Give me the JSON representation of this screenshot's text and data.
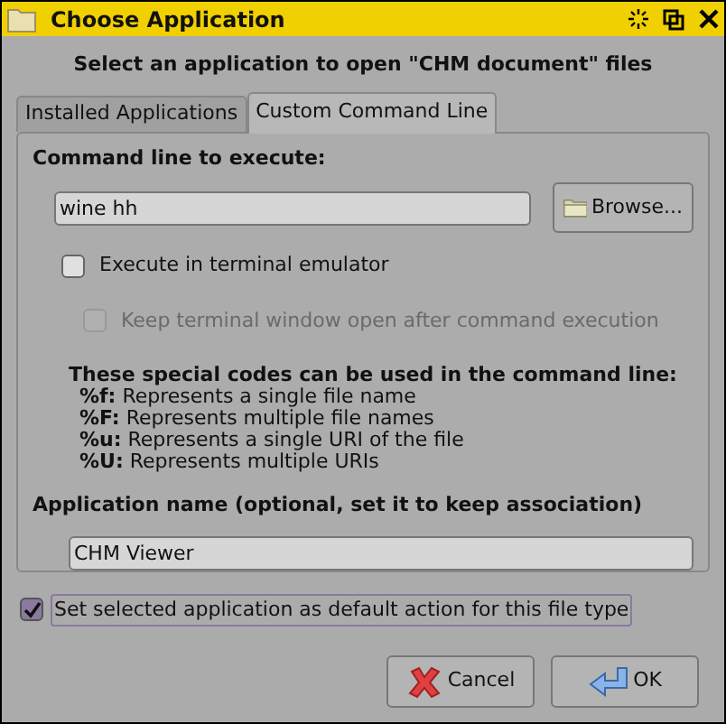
{
  "window": {
    "title": "Choose Application"
  },
  "message": "Select an application to open \"CHM document\" files",
  "tabs": [
    {
      "label": "Installed Applications",
      "selected": false
    },
    {
      "label": "Custom Command Line",
      "selected": true
    }
  ],
  "command_label": "Command line to execute:",
  "command_field": {
    "value": "wine hh"
  },
  "browse_button": "Browse...",
  "options": [
    {
      "label": "Execute in terminal emulator",
      "checked": false,
      "disabled": false
    },
    {
      "label": "Keep terminal window open after command execution",
      "checked": false,
      "disabled": true
    }
  ],
  "codes_heading": "These special codes can be used in the command line:",
  "codes": [
    {
      "code": "%f:",
      "text": "Represents a single file name"
    },
    {
      "code": "%F:",
      "text": "Represents multiple file names"
    },
    {
      "code": "%u:",
      "text": "Represents a single URI of the file"
    },
    {
      "code": "%U:",
      "text": "Represents multiple URIs"
    }
  ],
  "app_name_label": "Application name (optional, set it to keep association)",
  "app_name_field": {
    "value": "CHM Viewer"
  },
  "default_checkbox": {
    "label": "Set selected application as default action for this file type",
    "checked": true
  },
  "buttons": [
    {
      "label": "Cancel",
      "kind": "cancel"
    },
    {
      "label": "OK",
      "kind": "ok"
    }
  ]
}
